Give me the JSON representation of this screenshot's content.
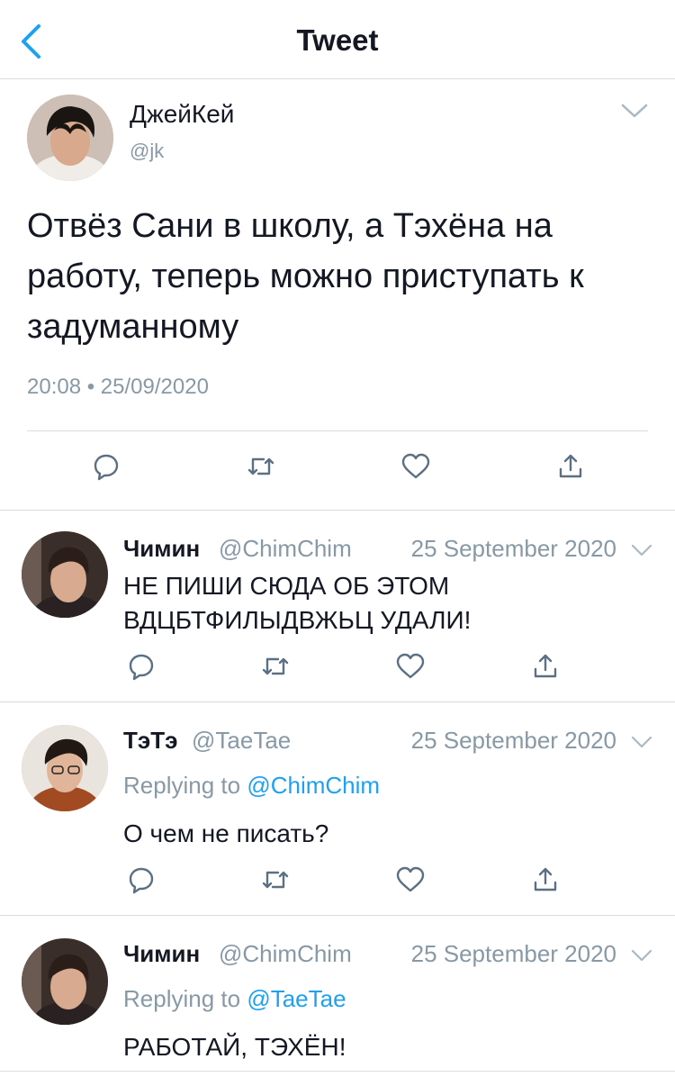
{
  "header": {
    "title": "Tweet",
    "back_icon": "chevron-left-icon"
  },
  "main_tweet": {
    "author_name": "ДжейКей",
    "handle": "@jk",
    "text": "Отвёз Сани в школу, а Тэхёна на работу, теперь можно приступать к задуманному",
    "timestamp": "20:08 • 25/09/2020",
    "actions": [
      "reply-icon",
      "retweet-icon",
      "like-icon",
      "share-icon"
    ]
  },
  "replies": [
    {
      "author_name": "Чимин",
      "handle": "@ChimChim",
      "date": "25 September 2020",
      "text_lines": [
        "НЕ ПИШИ СЮДА ОБ ЭТОМ",
        "ВДЦБТФИЛЫДВЖЬЦ УДАЛИ!"
      ]
    },
    {
      "author_name": "ТэТэ",
      "handle": "@TaeTae",
      "date": "25 September 2020",
      "replying_prefix": "Replying to",
      "replying_to": "@ChimChim",
      "text": "О чем не писать?"
    },
    {
      "author_name": "Чимин",
      "handle": "@ChimChim",
      "date": "25 September 2020",
      "replying_prefix": "Replying to",
      "replying_to": "@TaeTae",
      "text": "РАБОТАЙ, ТЭХЁН!"
    }
  ],
  "colors": {
    "accent": "#1da1f2",
    "muted": "#8899a6",
    "text": "#141823",
    "divider": "#d8dde1",
    "icon": "#5b7083"
  }
}
